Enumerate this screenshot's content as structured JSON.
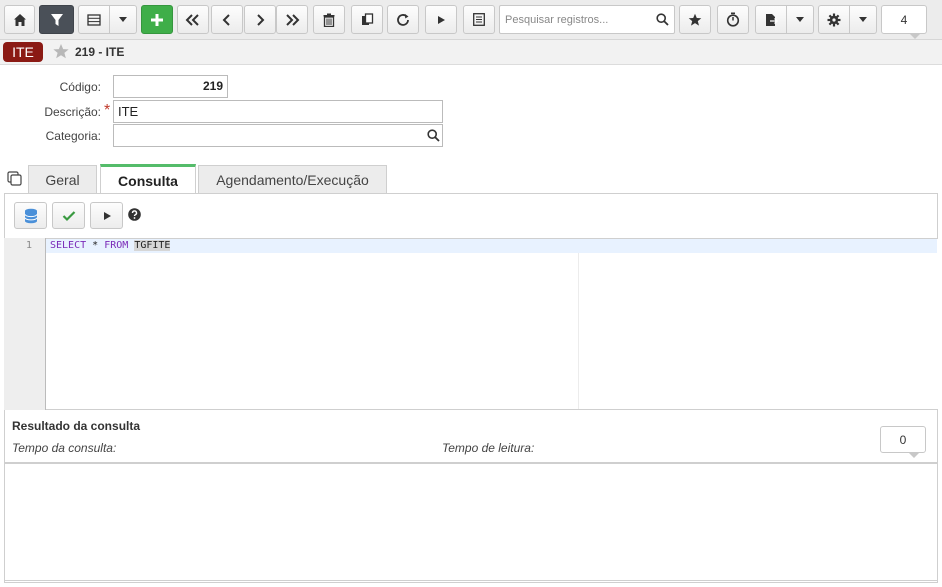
{
  "toolbar": {
    "search_placeholder": "Pesquisar registros...",
    "record_count": "4",
    "icons": [
      "home-icon",
      "filter-icon",
      "grid-icon",
      "chevron-down-icon",
      "plus-icon",
      "first-icon",
      "prev-icon",
      "next-icon",
      "last-icon",
      "trash-icon",
      "copy-icon",
      "refresh-icon",
      "play-icon",
      "list-icon",
      "search-icon",
      "star-icon",
      "timer-icon",
      "export-icon",
      "gear-icon"
    ]
  },
  "header": {
    "entity_badge": "ITE",
    "record_title": "219 - ITE"
  },
  "form": {
    "codigo_label": "Código:",
    "codigo_value": "219",
    "descricao_label": "Descrição:",
    "descricao_value": "ITE",
    "categoria_label": "Categoria:",
    "categoria_value": ""
  },
  "tabs": [
    {
      "label": "Geral",
      "active": false
    },
    {
      "label": "Consulta",
      "active": true
    },
    {
      "label": "Agendamento/Execução",
      "active": false
    }
  ],
  "editor": {
    "line_number": "1",
    "kw_select": "SELECT",
    "star": " * ",
    "kw_from": "FROM",
    "table": "TGFITE"
  },
  "results": {
    "title": "Resultado da consulta",
    "tempo_consulta_label": "Tempo da consulta:",
    "tempo_leitura_label": "Tempo de leitura:",
    "row_count": "0"
  },
  "colors": {
    "accent_green": "#3fae49",
    "badge_red": "#8b1a14",
    "tab_active_bar": "#54bc6a"
  }
}
